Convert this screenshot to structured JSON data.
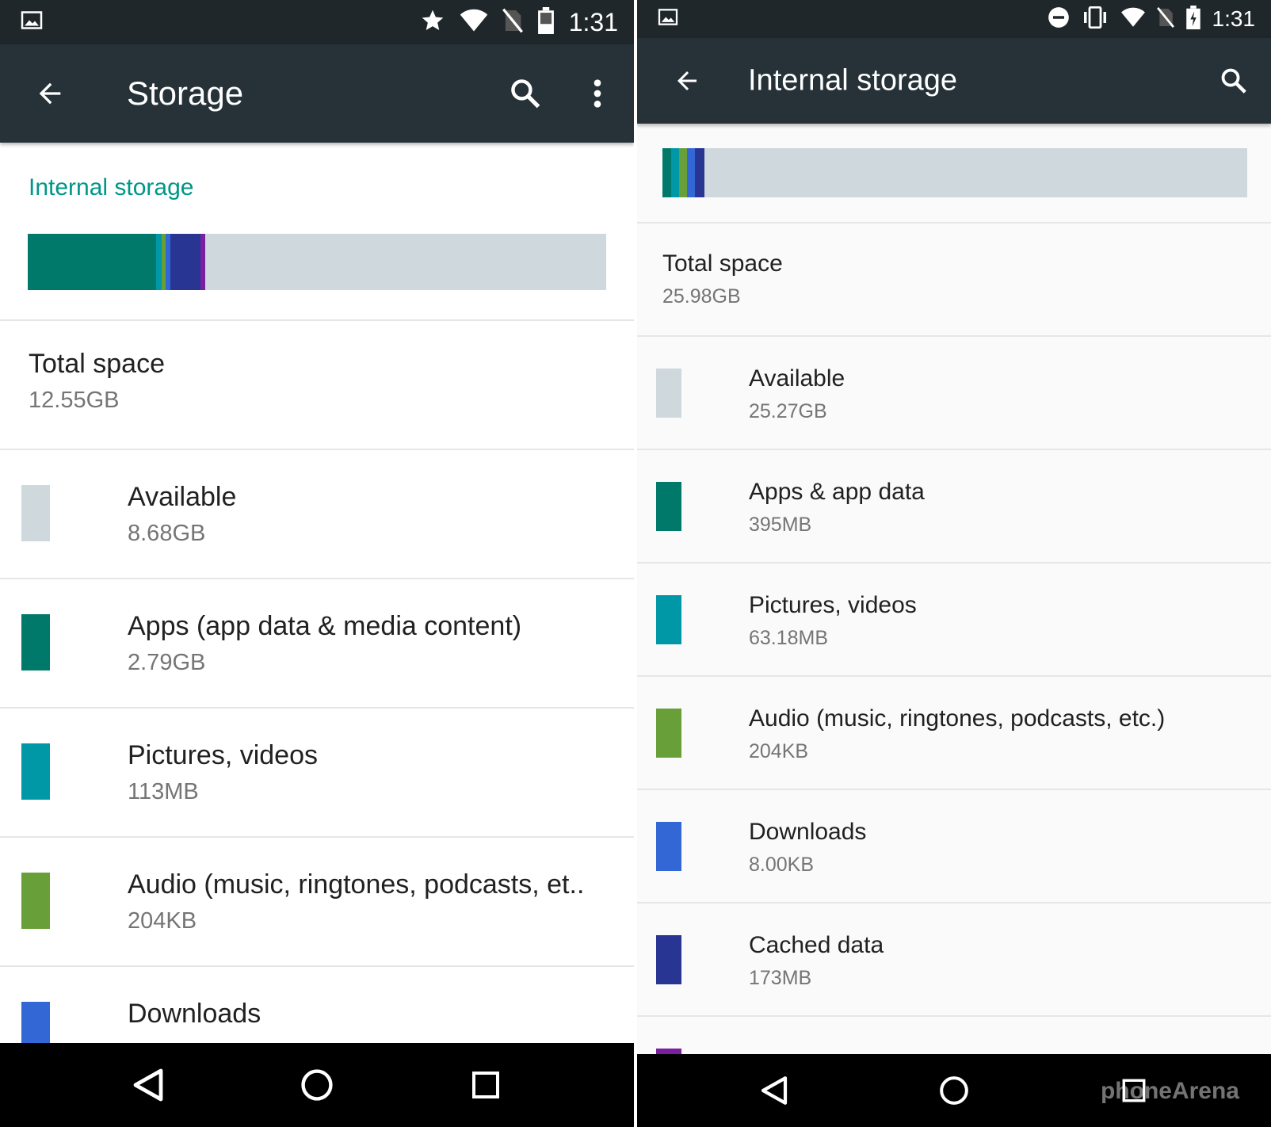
{
  "colors": {
    "statusbar": "#1f272b",
    "appbar": "#263238",
    "accent": "#009688",
    "available": "#cfd8dc",
    "apps": "#00796b",
    "pictures": "#0097a7",
    "audio": "#689f38",
    "downloads": "#3367d6",
    "cached": "#283593",
    "other": "#7b1fa2"
  },
  "left": {
    "status": {
      "time": "1:31",
      "icons": [
        "gallery-icon",
        "star-icon",
        "wifi-icon",
        "no-sim-icon",
        "battery-icon"
      ]
    },
    "appbar": {
      "title": "Storage",
      "icons": [
        "back-arrow-icon",
        "search-icon",
        "more-vert-icon"
      ]
    },
    "section_header": "Internal storage",
    "usage_bar": [
      {
        "name": "apps",
        "fraction": 0.222,
        "color": "#00796b"
      },
      {
        "name": "pictures",
        "fraction": 0.009,
        "color": "#0097a7"
      },
      {
        "name": "audio",
        "fraction": 0.008,
        "color": "#689f38"
      },
      {
        "name": "downloads",
        "fraction": 0.008,
        "color": "#3367d6"
      },
      {
        "name": "cached",
        "fraction": 0.052,
        "color": "#283593"
      },
      {
        "name": "other",
        "fraction": 0.008,
        "color": "#7b1fa2"
      }
    ],
    "total": {
      "label": "Total space",
      "value": "12.55GB"
    },
    "items": [
      {
        "label": "Available",
        "value": "8.68GB",
        "color": "#cfd8dc"
      },
      {
        "label": "Apps (app data & media content)",
        "value": "2.79GB",
        "color": "#00796b"
      },
      {
        "label": "Pictures, videos",
        "value": "113MB",
        "color": "#0097a7"
      },
      {
        "label": "Audio (music, ringtones, podcasts, et..",
        "value": "204KB",
        "color": "#689f38"
      },
      {
        "label": "Downloads",
        "value": "",
        "color": "#3367d6"
      }
    ],
    "navbar": [
      "back-nav-icon",
      "home-nav-icon",
      "recents-nav-icon"
    ]
  },
  "right": {
    "status": {
      "time": "1:31",
      "icons": [
        "gallery-icon",
        "dnd-icon",
        "vibrate-icon",
        "wifi-icon",
        "no-sim-icon",
        "battery-charging-icon"
      ]
    },
    "appbar": {
      "title": "Internal storage",
      "icons": [
        "back-arrow-icon",
        "search-icon"
      ]
    },
    "usage_bar": [
      {
        "name": "apps",
        "fraction": 0.015,
        "color": "#00796b"
      },
      {
        "name": "pictures",
        "fraction": 0.014,
        "color": "#0097a7"
      },
      {
        "name": "audio",
        "fraction": 0.013,
        "color": "#689f38"
      },
      {
        "name": "downloads",
        "fraction": 0.013,
        "color": "#3367d6"
      },
      {
        "name": "cached",
        "fraction": 0.017,
        "color": "#283593"
      }
    ],
    "total": {
      "label": "Total space",
      "value": "25.98GB"
    },
    "items": [
      {
        "label": "Available",
        "value": "25.27GB",
        "color": "#cfd8dc"
      },
      {
        "label": "Apps & app data",
        "value": "395MB",
        "color": "#00796b"
      },
      {
        "label": "Pictures, videos",
        "value": "63.18MB",
        "color": "#0097a7"
      },
      {
        "label": "Audio (music, ringtones, podcasts, etc.)",
        "value": "204KB",
        "color": "#689f38"
      },
      {
        "label": "Downloads",
        "value": "8.00KB",
        "color": "#3367d6"
      },
      {
        "label": "Cached data",
        "value": "173MB",
        "color": "#283593"
      },
      {
        "label": "",
        "value": "",
        "color": "#7b1fa2"
      }
    ],
    "navbar": [
      "back-nav-icon",
      "home-nav-icon",
      "recents-nav-icon"
    ],
    "watermark": "phoneArena"
  }
}
